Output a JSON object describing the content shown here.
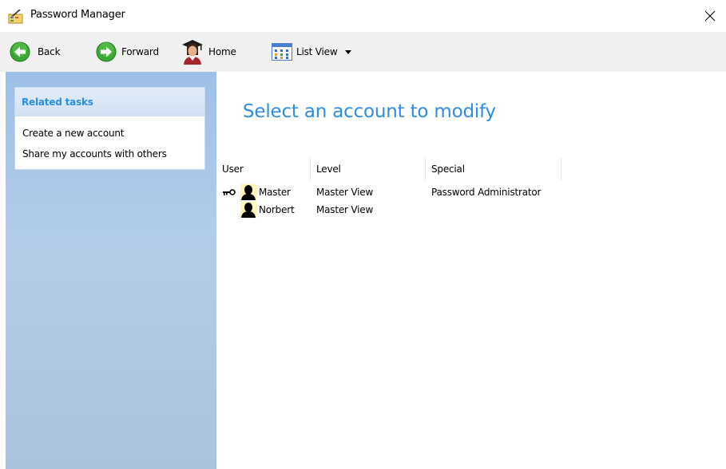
{
  "window": {
    "title": "Password Manager",
    "icons": {
      "app": "notepad-pencil-icon",
      "close": "close-icon"
    }
  },
  "toolbar": {
    "back_label": "Back",
    "forward_label": "Forward",
    "home_label": "Home",
    "view_label": "List View",
    "icons": {
      "back": "green-arrow-left-icon",
      "forward": "green-arrow-right-icon",
      "home": "graduate-person-icon",
      "view": "list-view-grid-icon",
      "dropdown": "caret-down-icon"
    }
  },
  "sidebar": {
    "panel_title": "Related tasks",
    "tasks": [
      "Create a new account",
      "Share my accounts with others"
    ]
  },
  "main": {
    "title": "Select an account to modify",
    "columns": [
      "User",
      "Level",
      "Special"
    ],
    "rows": [
      {
        "user": "Master",
        "level": "Master View",
        "special": "Password Administrator",
        "has_key": true
      },
      {
        "user": "Norbert",
        "level": "Master View",
        "special": "",
        "has_key": false
      }
    ],
    "icons": {
      "key": "key-icon",
      "user": "user-silhouette-icon"
    }
  },
  "colors": {
    "accent_blue": "#2d8de2",
    "sidebar_blue": "#a9c3de",
    "toolbar_gray": "#f0f0f0"
  }
}
